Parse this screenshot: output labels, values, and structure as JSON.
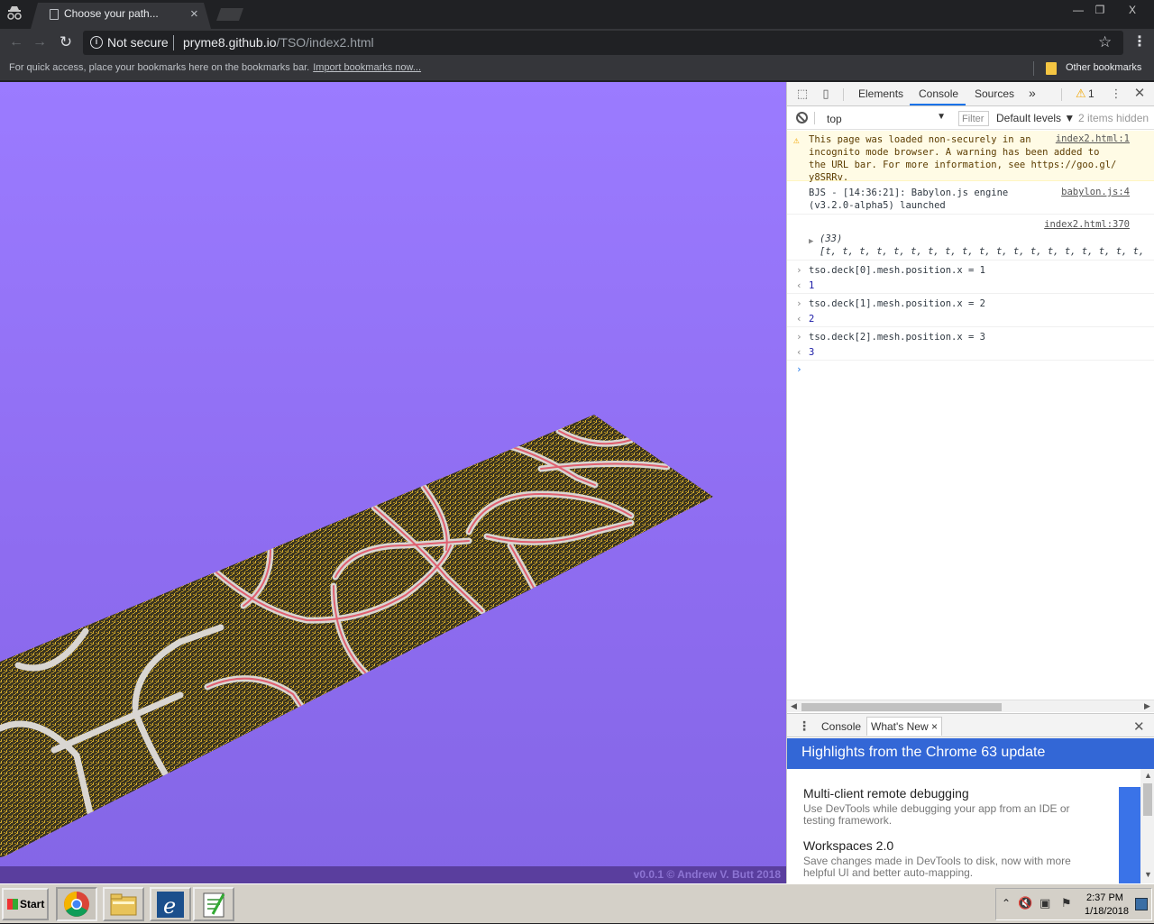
{
  "browser": {
    "tab_title": "Choose your path...",
    "tab_close": "×",
    "not_secure_label": "Not secure",
    "url_host": "pryme8.github.io",
    "url_path": "/TSO/index2.html",
    "bookmarks_text": "For quick access, place your bookmarks here on the bookmarks bar.",
    "bookmarks_import": "Import bookmarks now...",
    "other_bookmarks": "Other bookmarks",
    "window_min": "—",
    "window_max": "❐",
    "window_close": "X"
  },
  "page": {
    "background_top": "#9b7bff",
    "background_bottom": "#8466e6",
    "credit": "v0.0.1 © Andrew V. Butt 2018"
  },
  "devtools": {
    "tabs": {
      "elements": "Elements",
      "console": "Console",
      "sources": "Sources",
      "more": "»"
    },
    "warning_count": "1",
    "context": "top",
    "filter_placeholder": "Filter",
    "levels": "Default levels ▼",
    "hidden": "2 items hidden",
    "messages": {
      "warn_text": "This page was loaded non-securely in an\nincognito mode browser. A warning has been added to\nthe URL bar. For more information, see https://goo.gl/\ny8SRRv.",
      "warn_src": "index2.html:1",
      "bjs_text": "BJS - [14:36:21]: Babylon.js engine\n(v3.2.0-alpha5) launched",
      "bjs_src": "babylon.js:4",
      "array_src": "index2.html:370",
      "array_text": "(33)\n[t, t, t, t, t, t, t, t, t, t, t, t, t, t, t, t, t, t, t,",
      "cmd1": "tso.deck[0].mesh.position.x = 1",
      "res1": "1",
      "cmd2": "tso.deck[1].mesh.position.x = 2",
      "res2": "2",
      "cmd3": "tso.deck[2].mesh.position.x = 3",
      "res3": "3"
    },
    "drawer": {
      "console": "Console",
      "whats_new": "What's New ×",
      "banner": "Highlights from the Chrome 63 update",
      "item1_title": "Multi-client remote debugging",
      "item1_desc": "Use DevTools while debugging your app from an IDE or testing framework.",
      "item2_title": "Workspaces 2.0",
      "item2_desc": "Save changes made in DevTools to disk, now with more helpful UI and better auto-mapping."
    }
  },
  "taskbar": {
    "start": "Start",
    "time": "2:37 PM",
    "date": "1/18/2018"
  }
}
